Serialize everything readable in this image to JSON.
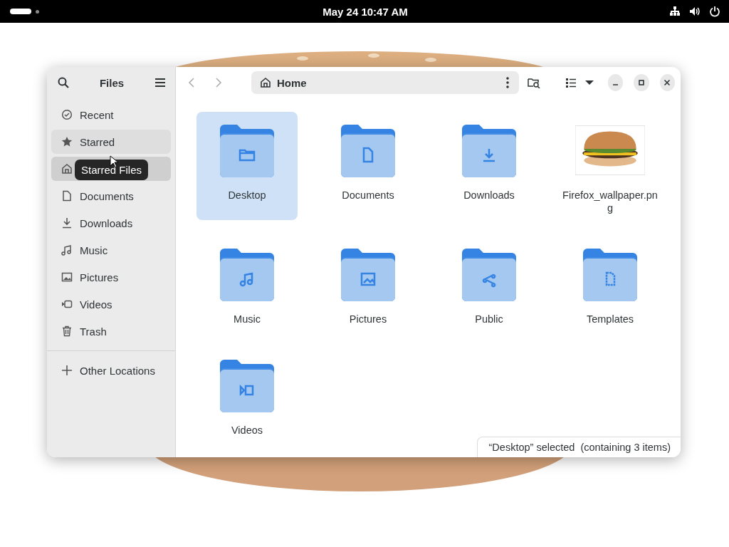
{
  "top_bar": {
    "clock": "May 24  10:47 AM"
  },
  "sidebar": {
    "title": "Files",
    "items": [
      {
        "label": "Recent",
        "selected": false,
        "hovered": false
      },
      {
        "label": "Starred",
        "selected": false,
        "hovered": true
      },
      {
        "selected": true,
        "hovered": false
      },
      {
        "label": "Documents",
        "selected": false,
        "hovered": false
      },
      {
        "label": "Downloads",
        "selected": false,
        "hovered": false
      },
      {
        "label": "Music",
        "selected": false,
        "hovered": false
      },
      {
        "label": "Pictures",
        "selected": false,
        "hovered": false
      },
      {
        "label": "Videos",
        "selected": false,
        "hovered": false
      },
      {
        "label": "Trash",
        "selected": false,
        "hovered": false
      }
    ],
    "other": "Other Locations",
    "tooltip": "Starred Files"
  },
  "path_bar": {
    "location": "Home"
  },
  "files": [
    {
      "kind": "folder",
      "name": "Desktop",
      "selected": true
    },
    {
      "kind": "folder",
      "name": "Documents",
      "selected": false
    },
    {
      "kind": "folder",
      "name": "Downloads",
      "selected": false
    },
    {
      "kind": "picture",
      "name": "Firefox_wallpaper.png",
      "selected": false
    },
    {
      "kind": "folder",
      "name": "Music",
      "selected": false
    },
    {
      "kind": "folder",
      "name": "Pictures",
      "selected": false
    },
    {
      "kind": "folder",
      "name": "Public",
      "selected": false
    },
    {
      "kind": "folder",
      "name": "Templates",
      "selected": false
    },
    {
      "kind": "folder",
      "name": "Videos",
      "selected": false
    }
  ],
  "status": "“Desktop” selected  (containing 3 items)"
}
